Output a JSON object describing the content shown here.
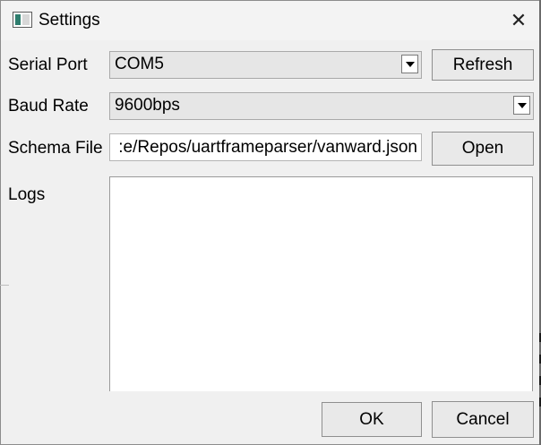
{
  "window": {
    "title": "Settings",
    "app_icon": "app-window-icon",
    "close_glyph": "✕",
    "close_icon": "close-icon"
  },
  "form": {
    "serial_port": {
      "label": "Serial Port",
      "value": "COM5",
      "refresh_label": "Refresh"
    },
    "baud_rate": {
      "label": "Baud Rate",
      "value": "9600bps"
    },
    "schema_file": {
      "label": "Schema File",
      "value": ":e/Repos/uartframeparser/vanward.json",
      "open_label": "Open"
    },
    "logs": {
      "label": "Logs",
      "value": ""
    }
  },
  "footer": {
    "ok_label": "OK",
    "cancel_label": "Cancel"
  },
  "colors": {
    "window_bg": "#f0f0f0",
    "button_bg": "#e9e9e9",
    "combo_bg": "#e6e6e6"
  }
}
